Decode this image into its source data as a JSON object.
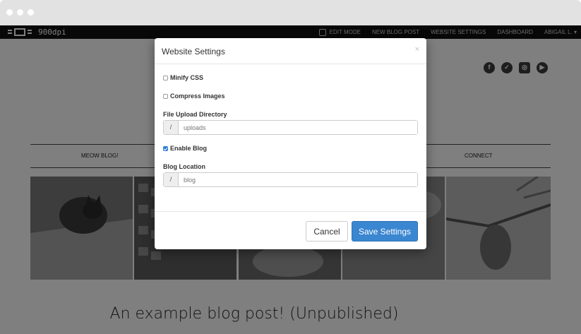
{
  "topnav": {
    "brand": "900dpi",
    "edit_mode": "EDIT MODE",
    "new_post": "NEW BLOG POST",
    "website_settings": "WEBSITE SETTINGS",
    "dashboard": "DASHBOARD",
    "user": "ABIGAIL L. ▾"
  },
  "menu": {
    "left": "MEOW BLOG!",
    "right": "CONNECT"
  },
  "social_icons": [
    "facebook-icon",
    "twitter-icon",
    "instagram-icon",
    "youtube-icon"
  ],
  "post": {
    "title": "An example blog post! (Unpublished)"
  },
  "modal": {
    "title": "Website Settings",
    "close": "×",
    "minify_css": {
      "label": "Minify CSS",
      "checked": false
    },
    "compress_images": {
      "label": "Compress Images",
      "checked": false
    },
    "upload_dir": {
      "label": "File Upload Directory",
      "prefix": "/",
      "placeholder": "uploads"
    },
    "enable_blog": {
      "label": "Enable Blog",
      "checked": true
    },
    "blog_location": {
      "label": "Blog Location",
      "prefix": "/",
      "placeholder": "blog"
    },
    "cancel_label": "Cancel",
    "save_label": "Save Settings"
  },
  "colors": {
    "accent": "#3a86d0",
    "topnav": "#111111",
    "overlay": "rgba(0,0,0,0.5)"
  }
}
